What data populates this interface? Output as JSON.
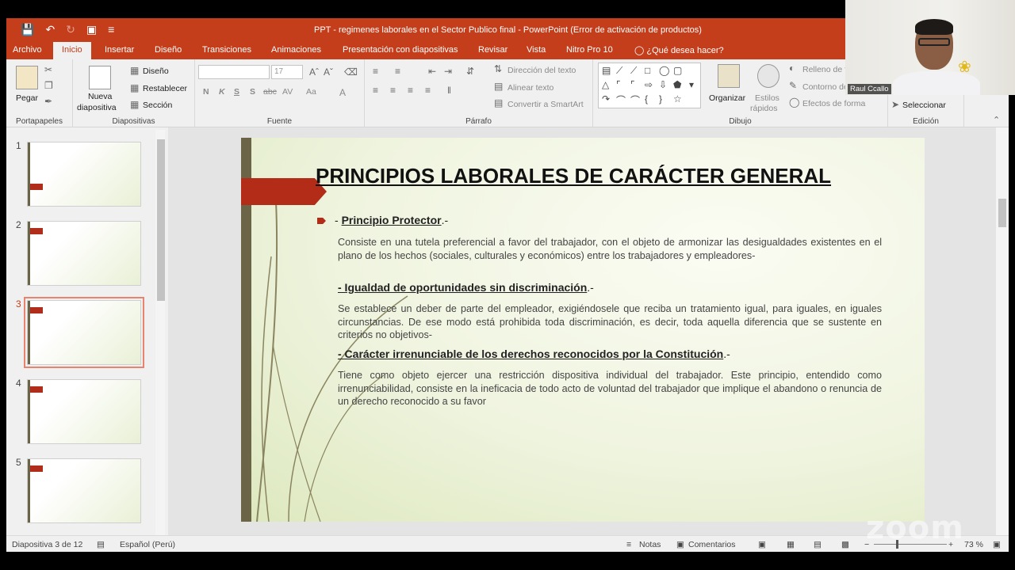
{
  "window": {
    "title": "PPT - regimenes laborales en el Sector Publico final - PowerPoint (Error de activación de productos)"
  },
  "quick_access": {
    "save_icon": "save-icon",
    "undo_icon": "undo-icon",
    "redo_icon": "redo-icon",
    "present_icon": "present-icon",
    "customize_icon": "customize-icon"
  },
  "tabs": [
    "Archivo",
    "Inicio",
    "Insertar",
    "Diseño",
    "Transiciones",
    "Animaciones",
    "Presentación con diapositivas",
    "Revisar",
    "Vista",
    "Nitro Pro 10",
    "¿Qué desea hacer?"
  ],
  "ribbon": {
    "portapapeles": {
      "label": "Portapapeles",
      "paste": "Pegar"
    },
    "diapositivas": {
      "label": "Diapositivas",
      "new_slide_1": "Nueva",
      "new_slide_2": "diapositiva",
      "layout": "Diseño",
      "reset": "Restablecer",
      "section": "Sección"
    },
    "fuente": {
      "label": "Fuente",
      "font_name": "",
      "font_size": "17",
      "bold": "N",
      "italic": "K",
      "underline": "S",
      "shadow": "S",
      "strike": "abc",
      "spacing": "AV",
      "case": "Aa"
    },
    "parrafo": {
      "label": "Párrafo",
      "text_direction": "Dirección del texto",
      "align_text": "Alinear texto",
      "smartart": "Convertir a SmartArt"
    },
    "dibujo": {
      "label": "Dibujo",
      "arrange": "Organizar",
      "quick_styles_1": "Estilos",
      "quick_styles_2": "rápidos",
      "fill": "Relleno de fo",
      "outline": "Contorno de",
      "effects": "Efectos de forma"
    },
    "edicion": {
      "label": "Edición",
      "select": "Seleccionar"
    }
  },
  "thumbnails": [
    {
      "num": "1",
      "selected": false
    },
    {
      "num": "2",
      "selected": false
    },
    {
      "num": "3",
      "selected": true
    },
    {
      "num": "4",
      "selected": false
    },
    {
      "num": "5",
      "selected": false
    }
  ],
  "slide": {
    "title": "PRINCIPIOS LABORALES DE CARÁCTER GENERAL",
    "h1_prefix": "- ",
    "h1": "Principio Protector",
    "h1_suffix": ".-",
    "p1": "Consiste en una tutela preferencial a favor del trabajador, con el objeto de armonizar las desigualdades existentes en el plano de los hechos (sociales, culturales y económicos) entre los trabajadores y empleadores-",
    "h2": "-  Igualdad de oportunidades sin discriminación",
    "h2_suffix": ".-",
    "p2": "Se establece un deber de parte del empleador, exigiéndosele que reciba un tratamiento igual, para iguales, en iguales circunstancias. De ese modo está prohibida toda discriminación, es decir, toda aquella diferencia que se sustente en criterios no objetivos-",
    "h3": "- Carácter irrenunciable de los derechos reconocidos por la Constitución",
    "h3_suffix": ".-",
    "p3": "Tiene como objeto ejercer una restricción dispositiva individual del trabajador. Este principio, entendido como irrenunciabilidad, consiste en la ineficacia de todo acto de voluntad del trabajador que implique el abandono o renuncia de un derecho reconocido a su favor"
  },
  "status": {
    "slide_info": "Diapositiva 3 de 12",
    "language": "Español (Perú)",
    "notes": "Notas",
    "comments": "Comentarios",
    "zoom": "73 %",
    "zoom_level_percent": 73
  },
  "webcam": {
    "name": "Raul Ccallo"
  },
  "watermark": "zoom",
  "colors": {
    "accent": "#c43e1c",
    "slide_flag": "#b22c17",
    "slide_bar": "#6b6446"
  }
}
